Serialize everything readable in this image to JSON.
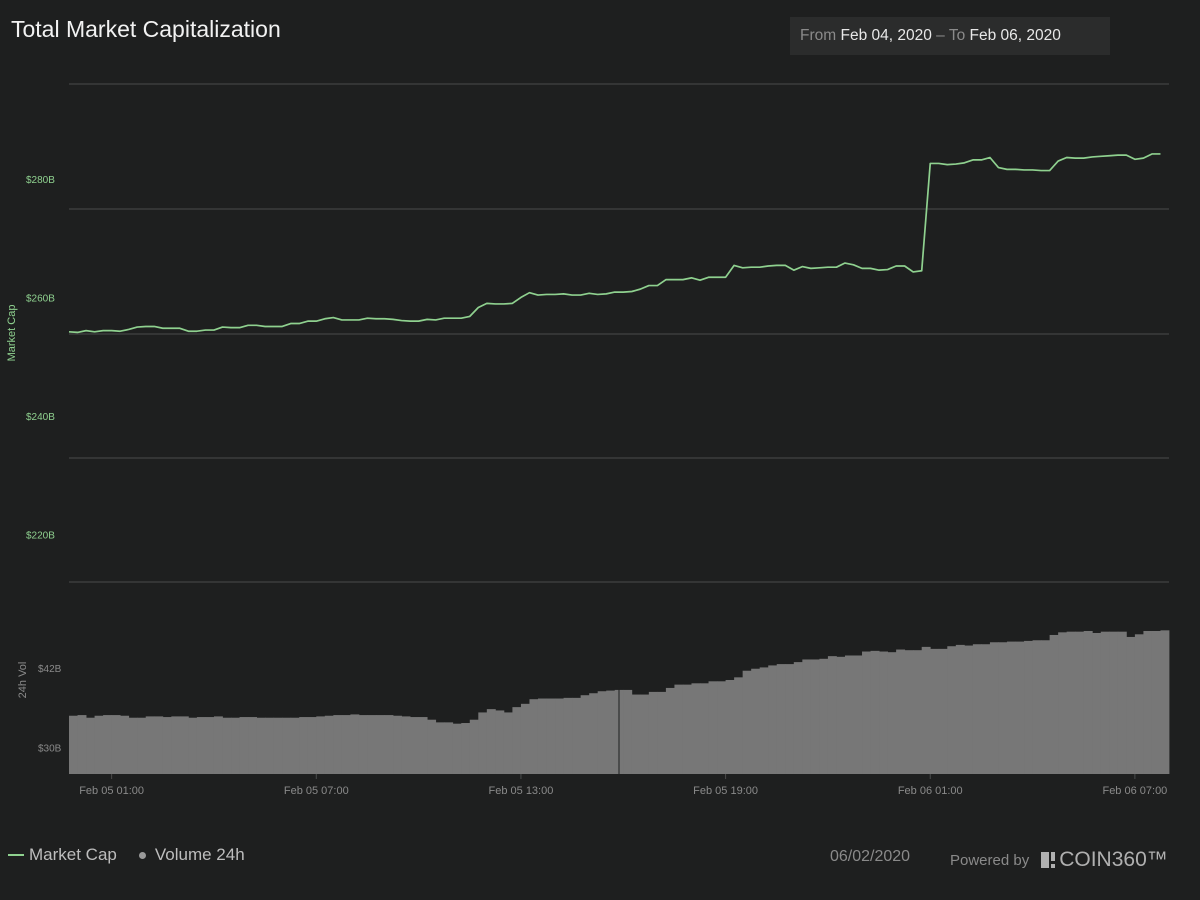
{
  "header": {
    "title": "Total Market Capitalization",
    "range_from_label": "From",
    "range_from_value": "Feb 04, 2020",
    "range_sep": "–",
    "range_to_label": "To",
    "range_to_value": "Feb 06, 2020"
  },
  "legend": {
    "market_cap": "Market Cap",
    "volume": "Volume 24h"
  },
  "footer": {
    "date": "06/02/2020",
    "powered_by": "Powered by",
    "brand": "COIN360™"
  },
  "colors": {
    "market_cap_line": "#8fd18f",
    "volume_bar": "#777777",
    "grid": "#4a4b4b",
    "tick_text": "#8a8a8a"
  },
  "chart_data": [
    {
      "type": "line",
      "ylabel": "Market Cap",
      "y_ticks": [
        "$220B",
        "$240B",
        "$260B",
        "$280B"
      ],
      "y_tick_values": [
        220,
        240,
        260,
        280
      ],
      "ylim": [
        212,
        296
      ],
      "grid": true,
      "x_ticks": [
        "Feb 05 01:00",
        "Feb 05 07:00",
        "Feb 05 13:00",
        "Feb 05 19:00",
        "Feb 06 01:00",
        "Feb 06 07:00"
      ],
      "x_tick_hours": [
        1,
        7,
        13,
        19,
        25,
        31
      ],
      "x_hours": [
        -0.25,
        0.0,
        0.25,
        0.5,
        0.75,
        1.0,
        1.25,
        1.5,
        1.75,
        2.0,
        2.25,
        2.5,
        2.75,
        3.0,
        3.25,
        3.5,
        3.75,
        4.0,
        4.25,
        4.5,
        4.75,
        5.0,
        5.25,
        5.5,
        5.75,
        6.0,
        6.25,
        6.5,
        6.75,
        7.0,
        7.25,
        7.5,
        7.75,
        8.0,
        8.25,
        8.5,
        8.75,
        9.0,
        9.25,
        9.5,
        9.75,
        10.0,
        10.25,
        10.5,
        10.75,
        11.0,
        11.25,
        11.5,
        11.75,
        12.0,
        12.25,
        12.5,
        12.75,
        13.0,
        13.25,
        13.5,
        13.75,
        14.0,
        14.25,
        14.5,
        14.75,
        15.0,
        15.25,
        15.5,
        15.75,
        16.0,
        16.25,
        16.5,
        16.75,
        17.0,
        17.25,
        17.5,
        17.75,
        18.0,
        18.25,
        18.5,
        18.75,
        19.0,
        19.25,
        19.5,
        19.75,
        20.0,
        20.25,
        20.5,
        20.75,
        21.0,
        21.25,
        21.5,
        21.75,
        22.0,
        22.25,
        22.5,
        22.75,
        23.0,
        23.25,
        23.5,
        23.75,
        24.0,
        24.25,
        24.5,
        24.75,
        25.0,
        25.25,
        25.5,
        25.75,
        26.0,
        26.25,
        26.5,
        26.75,
        27.0,
        27.25,
        27.5,
        27.75,
        28.0,
        28.25,
        28.5,
        28.75,
        29.0,
        29.25,
        29.5,
        29.75,
        30.0,
        30.25,
        30.5,
        30.75,
        31.0,
        31.25,
        31.5,
        31.75
      ],
      "series": [
        {
          "name": "Market Cap",
          "values": [
            254.2,
            254.1,
            254.4,
            254.2,
            254.4,
            254.4,
            254.3,
            254.6,
            255.0,
            255.1,
            255.1,
            254.8,
            254.8,
            254.8,
            254.3,
            254.3,
            254.5,
            254.5,
            255.0,
            254.9,
            254.9,
            255.3,
            255.3,
            255.1,
            255.1,
            255.1,
            255.6,
            255.6,
            256.0,
            256.0,
            256.4,
            256.6,
            256.2,
            256.2,
            256.2,
            256.5,
            256.4,
            256.4,
            256.3,
            256.1,
            256.0,
            256.0,
            256.3,
            256.2,
            256.5,
            256.5,
            256.5,
            256.8,
            258.3,
            259.0,
            258.9,
            258.9,
            259.0,
            260.0,
            260.8,
            260.4,
            260.5,
            260.5,
            260.6,
            260.4,
            260.4,
            260.7,
            260.5,
            260.6,
            260.9,
            260.9,
            261.0,
            261.4,
            262.0,
            262.0,
            263.0,
            263.0,
            263.0,
            263.3,
            262.9,
            263.4,
            263.4,
            263.4,
            265.4,
            265.0,
            265.1,
            265.1,
            265.3,
            265.4,
            265.4,
            264.6,
            265.2,
            264.9,
            265.0,
            265.1,
            265.1,
            265.8,
            265.5,
            264.9,
            264.9,
            264.6,
            264.7,
            265.3,
            265.3,
            264.3,
            264.5,
            282.6,
            282.6,
            282.4,
            282.5,
            282.7,
            283.2,
            283.2,
            283.6,
            281.9,
            281.6,
            281.6,
            281.5,
            281.5,
            281.4,
            281.4,
            283.0,
            283.6,
            283.5,
            283.5,
            283.7,
            283.8,
            283.9,
            284.0,
            284.0,
            283.3,
            283.5,
            284.2,
            284.2,
            284.3
          ]
        }
      ]
    },
    {
      "type": "bar",
      "ylabel": "24h Vol",
      "y_ticks": [
        "$30B",
        "$42B"
      ],
      "y_tick_values": [
        30,
        42
      ],
      "ylim": [
        26,
        55
      ],
      "x_ticks": [
        "Feb 05 01:00",
        "Feb 05 07:00",
        "Feb 05 13:00",
        "Feb 05 19:00",
        "Feb 06 01:00",
        "Feb 06 07:00"
      ],
      "series": [
        {
          "name": "Volume 24h",
          "values": [
            34.8,
            34.9,
            34.5,
            34.8,
            34.9,
            34.9,
            34.8,
            34.5,
            34.5,
            34.7,
            34.7,
            34.6,
            34.7,
            34.7,
            34.5,
            34.6,
            34.6,
            34.7,
            34.5,
            34.5,
            34.6,
            34.6,
            34.5,
            34.5,
            34.5,
            34.5,
            34.5,
            34.6,
            34.6,
            34.7,
            34.8,
            34.9,
            34.9,
            35.0,
            34.9,
            34.9,
            34.9,
            34.9,
            34.8,
            34.7,
            34.6,
            34.6,
            34.2,
            33.8,
            33.8,
            33.6,
            33.7,
            34.2,
            35.3,
            35.8,
            35.6,
            35.3,
            36.1,
            36.6,
            37.3,
            37.4,
            37.4,
            37.4,
            37.5,
            37.5,
            37.9,
            38.2,
            38.5,
            38.6,
            38.7,
            38.7,
            38.0,
            38.0,
            38.4,
            38.4,
            39.0,
            39.5,
            39.5,
            39.7,
            39.7,
            40.0,
            40.0,
            40.2,
            40.6,
            41.6,
            41.9,
            42.1,
            42.4,
            42.6,
            42.6,
            42.9,
            43.3,
            43.3,
            43.4,
            43.8,
            43.7,
            43.9,
            43.9,
            44.5,
            44.6,
            44.5,
            44.4,
            44.8,
            44.7,
            44.7,
            45.2,
            44.9,
            44.9,
            45.3,
            45.5,
            45.4,
            45.6,
            45.6,
            45.9,
            45.9,
            46.0,
            46.0,
            46.1,
            46.2,
            46.2,
            47.0,
            47.4,
            47.5,
            47.5,
            47.6,
            47.3,
            47.5,
            47.5,
            47.5,
            46.7,
            47.1,
            47.6,
            47.6,
            47.7
          ]
        }
      ]
    }
  ]
}
